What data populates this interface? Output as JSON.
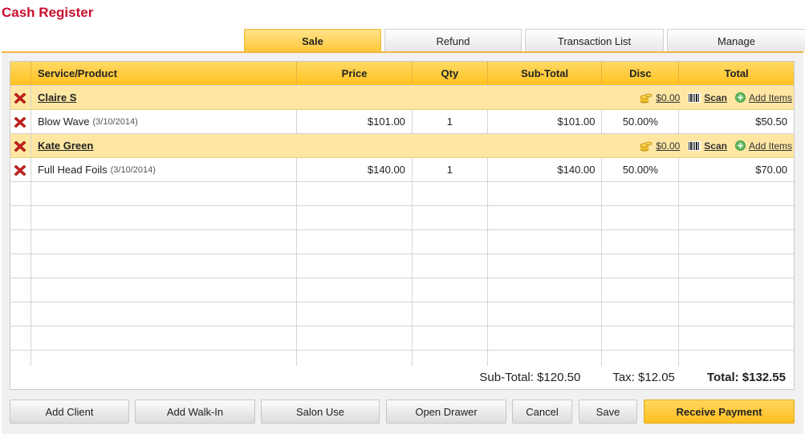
{
  "title": "Cash Register",
  "tabs": {
    "sale": "Sale",
    "refund": "Refund",
    "transaction_list": "Transaction List",
    "manage": "Manage"
  },
  "columns": {
    "service": "Service/Product",
    "price": "Price",
    "qty": "Qty",
    "subtotal": "Sub-Total",
    "disc": "Disc",
    "total": "Total"
  },
  "groups": [
    {
      "client": "Claire S",
      "discount_amount": "$0.00",
      "scan_label": "Scan",
      "add_items_label": "Add Items",
      "item": {
        "name": "Blow Wave",
        "date": "(3/10/2014)",
        "price": "$101.00",
        "qty": "1",
        "subtotal": "$101.00",
        "disc": "50.00%",
        "total": "$50.50"
      }
    },
    {
      "client": "Kate Green",
      "discount_amount": "$0.00",
      "scan_label": "Scan",
      "add_items_label": "Add Items",
      "item": {
        "name": "Full Head Foils",
        "date": "(3/10/2014)",
        "price": "$140.00",
        "qty": "1",
        "subtotal": "$140.00",
        "disc": "50.00%",
        "total": "$70.00"
      }
    }
  ],
  "summary": {
    "subtotal": "Sub-Total: $120.50",
    "tax": "Tax: $12.05",
    "total": "Total: $132.55"
  },
  "buttons": {
    "add_client": "Add Client",
    "add_walkin": "Add Walk-In",
    "salon_use": "Salon Use",
    "open_drawer": "Open Drawer",
    "cancel": "Cancel",
    "save": "Save",
    "receive_payment": "Receive Payment"
  },
  "colors": {
    "title": "#c8102e",
    "accent": "#ffc738",
    "client_row": "#ffe7a3",
    "delete_icon": "#cc1f1f"
  }
}
